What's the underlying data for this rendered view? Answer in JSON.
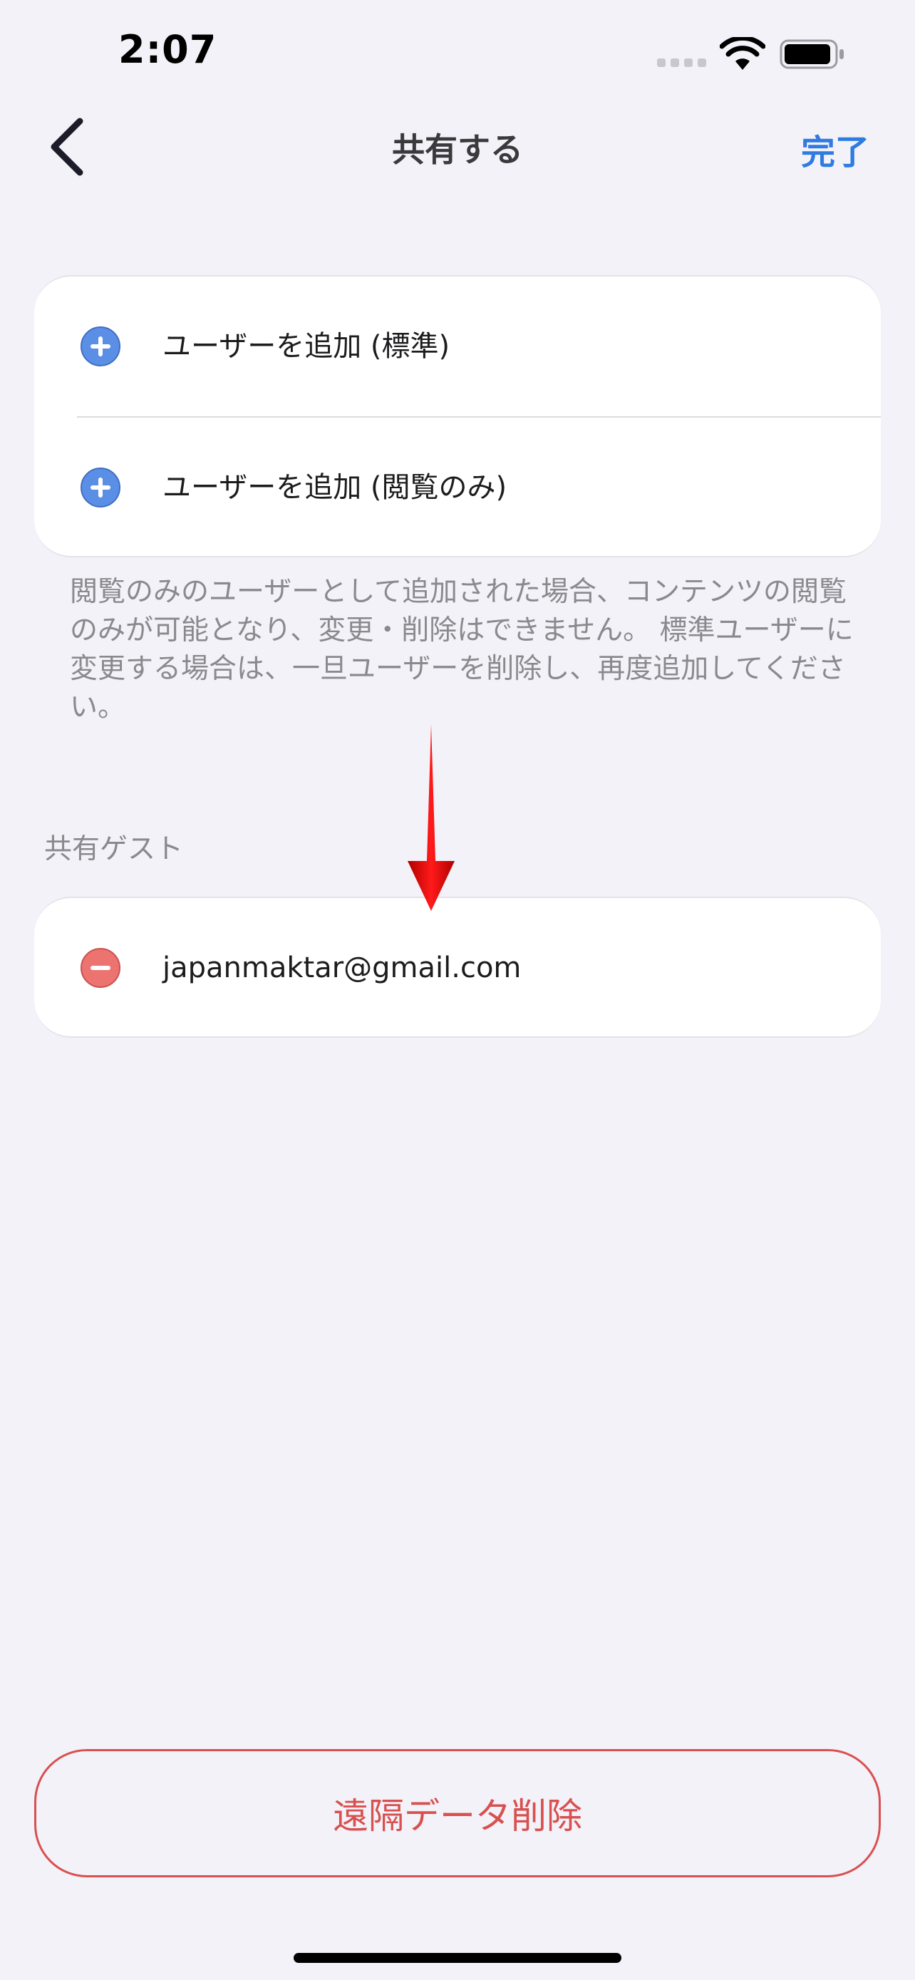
{
  "status_bar": {
    "time": "2:07",
    "icons": [
      "signal-icon",
      "wifi-icon",
      "battery-icon"
    ]
  },
  "nav": {
    "back_icon": "chevron-left-icon",
    "title": "共有する",
    "done_label": "完了"
  },
  "add_users": {
    "items": [
      {
        "label": "ユーザーを追加 (標準)",
        "icon": "plus-circle-icon"
      },
      {
        "label": "ユーザーを追加 (閲覧のみ)",
        "icon": "plus-circle-icon"
      }
    ],
    "note": "閲覧のみのユーザーとして追加された場合、コンテンツの閲覧のみが可能となり、変更・削除はできません。 標準ユーザーに変更する場合は、一旦ユーザーを削除し、再度追加してください。"
  },
  "guests": {
    "header": "共有ゲスト",
    "items": [
      {
        "email": "japanmaktar@gmail.com",
        "icon": "minus-circle-icon"
      }
    ]
  },
  "footer": {
    "delete_label": "遠隔データ削除"
  },
  "colors": {
    "background": "#f3f2f8",
    "accent_blue": "#2f7be2",
    "add_icon_blue": "#5b8fe6",
    "remove_icon_red": "#ec7370",
    "destructive_red": "#d8504f",
    "annotation_arrow": "#e00000"
  }
}
